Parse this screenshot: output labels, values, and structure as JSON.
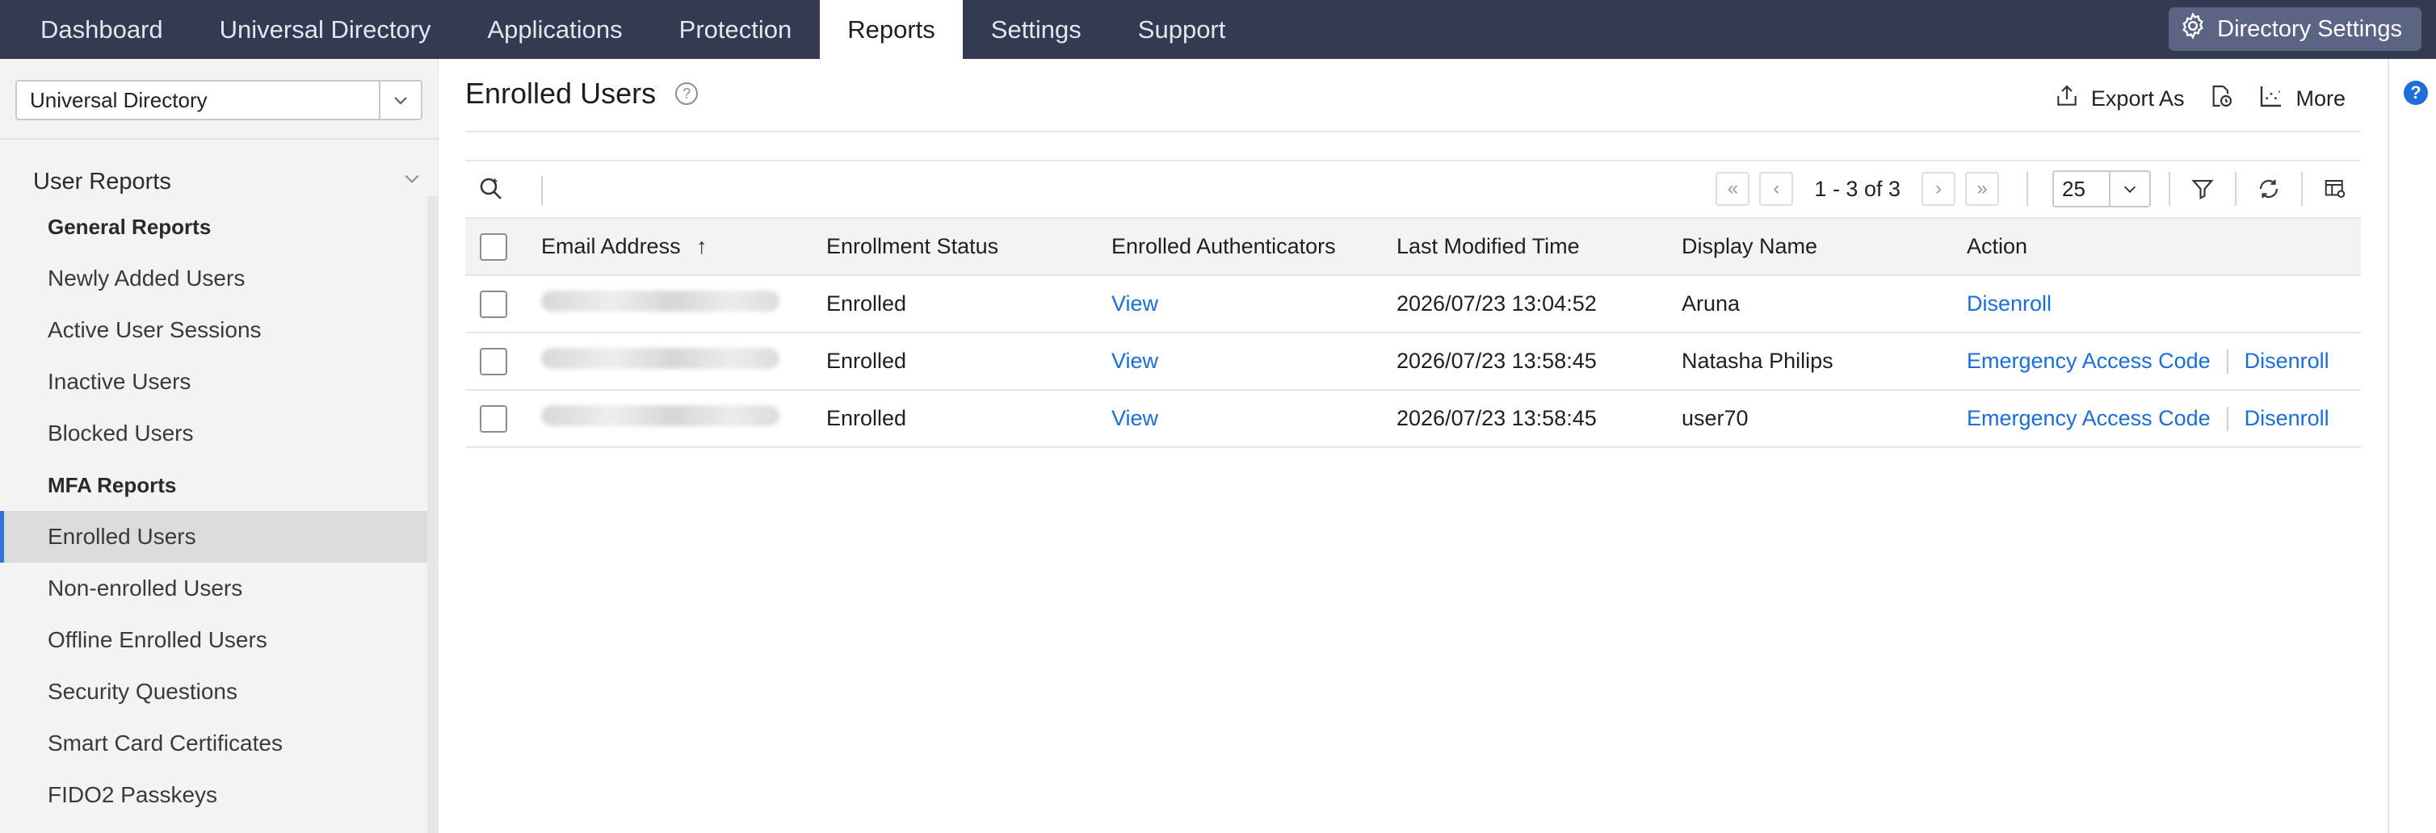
{
  "topnav": {
    "tabs": [
      "Dashboard",
      "Universal Directory",
      "Applications",
      "Protection",
      "Reports",
      "Settings",
      "Support"
    ],
    "active_tab": "Reports",
    "directory_settings": "Directory Settings"
  },
  "sidebar": {
    "directory_select": "Universal Directory",
    "section": "User Reports",
    "items": [
      {
        "label": "General Reports",
        "type": "group"
      },
      {
        "label": "Newly Added Users"
      },
      {
        "label": "Active User Sessions"
      },
      {
        "label": "Inactive Users"
      },
      {
        "label": "Blocked Users"
      },
      {
        "label": "MFA Reports",
        "type": "group"
      },
      {
        "label": "Enrolled Users",
        "active": true
      },
      {
        "label": "Non-enrolled Users"
      },
      {
        "label": "Offline Enrolled Users"
      },
      {
        "label": "Security Questions"
      },
      {
        "label": "Smart Card Certificates"
      },
      {
        "label": "FIDO2 Passkeys"
      }
    ]
  },
  "main": {
    "title": "Enrolled Users",
    "help": "?",
    "export_label": "Export As",
    "more_label": "More",
    "pager": {
      "range": "1 - 3 of 3",
      "page_size": "25"
    },
    "columns": [
      "Email Address",
      "Enrollment Status",
      "Enrolled Authenticators",
      "Last Modified Time",
      "Display Name",
      "Action"
    ],
    "sort_indicator": "↑",
    "rows": [
      {
        "status": "Enrolled",
        "authenticators": "View",
        "modified": "2026/07/23 13:04:52",
        "display_name": "Aruna",
        "actions": [
          "Disenroll"
        ]
      },
      {
        "status": "Enrolled",
        "authenticators": "View",
        "modified": "2026/07/23 13:58:45",
        "display_name": "Natasha Philips",
        "actions": [
          "Emergency Access Code",
          "Disenroll"
        ]
      },
      {
        "status": "Enrolled",
        "authenticators": "View",
        "modified": "2026/07/23 13:58:45",
        "display_name": "user70",
        "actions": [
          "Emergency Access Code",
          "Disenroll"
        ]
      }
    ]
  },
  "help_fab": "?",
  "colors": {
    "nav_bg": "#333a52",
    "accent": "#1a6ed8",
    "active_marker": "#2f72dd"
  }
}
